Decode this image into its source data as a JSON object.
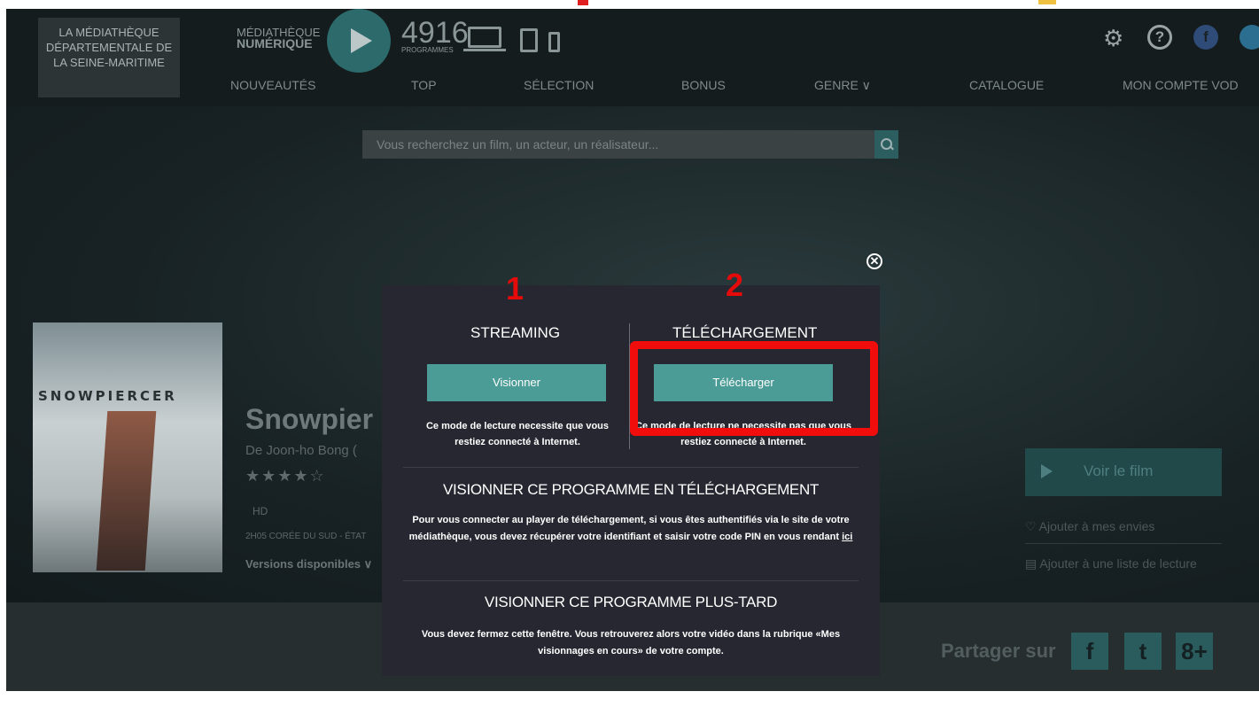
{
  "header": {
    "library_name": "LA MÉDIATHÈQUE DÉPARTEMENTALE DE LA SEINE-MARITIME",
    "brand_line1": "MÉDIATHÈQUE",
    "brand_line2": "NUMÉRIQUE",
    "programs_count": "4916",
    "programs_label": "PROGRAMMES"
  },
  "nav": {
    "items": [
      "NOUVEAUTÉS",
      "TOP",
      "SÉLECTION",
      "BONUS",
      "GENRE ∨",
      "CATALOGUE",
      "MON COMPTE VOD"
    ]
  },
  "search": {
    "placeholder": "Vous recherchez un film, un acteur, un réalisateur..."
  },
  "film": {
    "poster_title": "SNOWPIERCER",
    "title": "Snowpier",
    "director": "De Joon-ho Bong (",
    "stars": "★★★★☆",
    "quality": "HD",
    "meta": "2H05   CORÉE DU SUD - ÉTAT",
    "versions_label": "Versions disponibles ∨"
  },
  "actions": {
    "watch": "Voir le film",
    "wishlist": "Ajouter à mes envies",
    "playlist": "Ajouter à une liste de lecture"
  },
  "share": {
    "label": "Partager sur",
    "facebook": "f",
    "twitter": "t",
    "gplus": "8+"
  },
  "modal": {
    "close_glyph": "✕",
    "streaming_title": "STREAMING",
    "streaming_button": "Visionner",
    "streaming_desc": "Ce mode de lecture necessite que vous restiez connecté à Internet.",
    "download_title": "TÉLÉCHARGEMENT",
    "download_button": "Télécharger",
    "download_desc": "Ce mode de lecture ne necessite pas que vous restiez connecté à Internet.",
    "section1_title": "VISIONNER CE PROGRAMME EN TÉLÉCHARGEMENT",
    "section1_text": "Pour vous connecter au player de téléchargement, si vous êtes authentifiés via le site de votre médiathèque, vous devez récupérer votre identifiant et saisir votre code PIN en vous rendant",
    "section1_link": "ici",
    "section2_title": "VISIONNER CE PROGRAMME PLUS-TARD",
    "section2_text": "Vous devez fermez cette fenêtre. Vous retrouverez alors votre vidéo dans la rubrique «Mes visionnages en cours» de votre compte."
  },
  "annotations": {
    "num1": "1",
    "num2": "2",
    "highlight_color": "#f20d0d"
  },
  "colors": {
    "accent": "#4b9b96",
    "modal_bg": "#262730",
    "page_bg": "#1a2224"
  }
}
